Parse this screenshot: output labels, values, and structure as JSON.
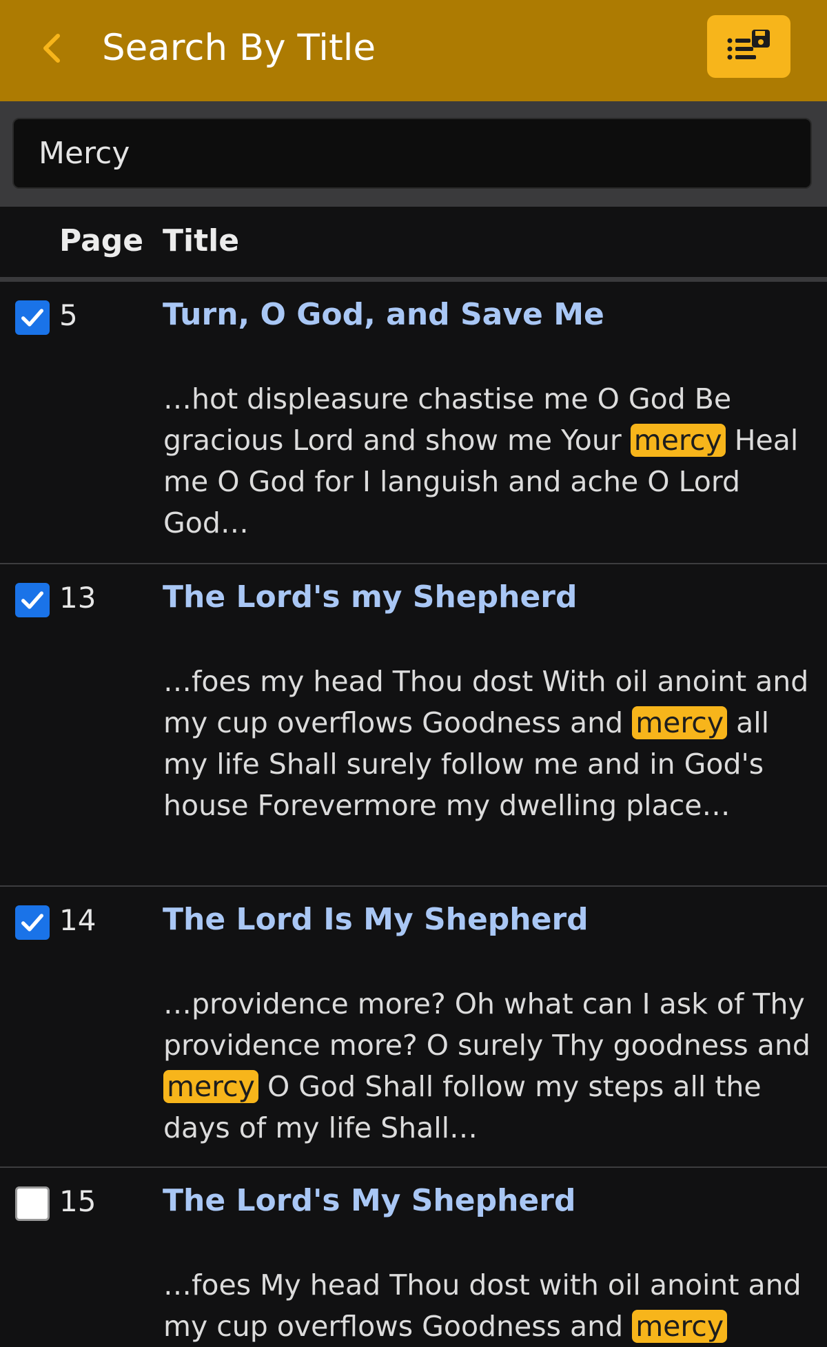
{
  "appbar": {
    "title": "Search By Title",
    "back_icon": "chevron-left-icon",
    "save_icon": "list-save-icon"
  },
  "search": {
    "value": "Mercy",
    "placeholder": ""
  },
  "table": {
    "headers": {
      "page": "Page",
      "title": "Title"
    },
    "rows": [
      {
        "checked": true,
        "page": "5",
        "title": "Turn, O God, and Save Me",
        "snippet_before": "…hot displeasure chastise me O God Be gracious Lord and show me Your ",
        "highlight": "mercy",
        "snippet_after": " Heal me O God for I languish and ache O Lord God…"
      },
      {
        "checked": true,
        "page": "13",
        "title": "The Lord's my Shepherd",
        "snippet_before": "…foes my head Thou dost With oil anoint and my cup overflows Goodness and ",
        "highlight": "mercy",
        "snippet_after": " all my life Shall surely follow me and in God's house Forevermore my dwelling place…"
      },
      {
        "checked": true,
        "page": "14",
        "title": "The Lord Is My Shepherd",
        "snippet_before": "…providence more? Oh what can I ask of Thy providence more? O surely Thy goodness and ",
        "highlight": "mercy",
        "snippet_after": " O God Shall follow my steps all the days of my life Shall…"
      },
      {
        "checked": false,
        "page": "15",
        "title": "The Lord's My Shepherd",
        "snippet_before": "…foes My head Thou dost with oil anoint and my cup overflows Goodness and ",
        "highlight": "mercy",
        "snippet_after": ""
      }
    ]
  },
  "colors": {
    "appbar": "#ad7b02",
    "accent": "#f7b51b",
    "title_link": "#a9c7f5",
    "checkbox": "#1a73e8"
  }
}
